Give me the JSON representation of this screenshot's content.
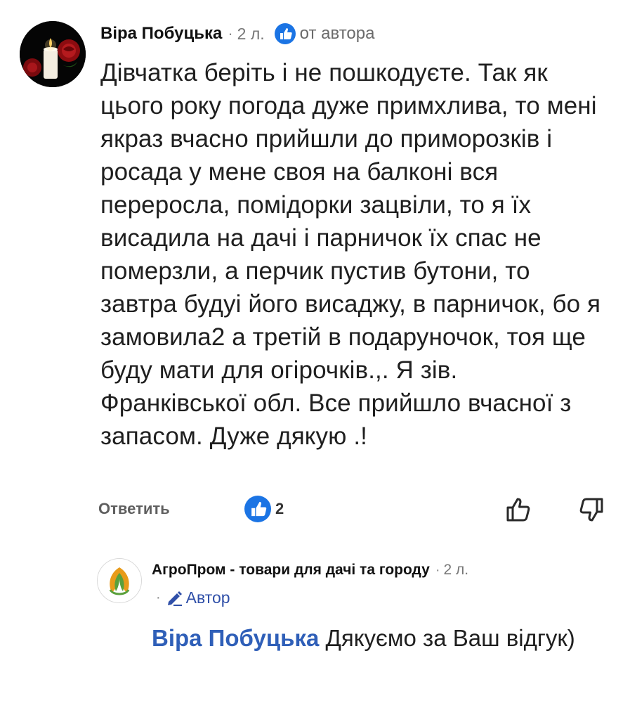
{
  "comment": {
    "author": "Віра Побуцька",
    "separator": "·",
    "time": "2 л.",
    "author_like_label": "от автора",
    "text": "Дівчатка беріть і не пошкодуєте. Так як цього року погода дуже примхлива, то мені якраз вчасно прийшли до приморозків і росада у мене своя на балконі вся переросла, помідорки зацвіли, то я їх висадила на дачі і парничок їх спас не померзли, а перчик пустив бутони, то завтра будуі його висаджу, в парничок, бо я замовила2 а третій в подаруночок, тоя ще буду мати для огірочків.,. Я зів. Франківської обл. Все прийшло вчасної з запасом. Дуже дякую .!",
    "reply_label": "Ответить",
    "like_count": "2"
  },
  "reply": {
    "author": "АгроПром - товари для дачі та городу",
    "separator": "·",
    "time": "2 л.",
    "separator2": "·",
    "badge": "Автор",
    "mention": "Віра Побуцька",
    "text": "Дякуємо за Ваш відгук)"
  },
  "colors": {
    "like_blue": "#1b74e4",
    "mention_blue": "#2f5fb8",
    "brand_orange": "#e89b1a",
    "brand_green": "#5aa03c"
  },
  "icons": {
    "like_badge": "thumbs-up-filled-icon",
    "thumb_up": "thumbs-up-outline-icon",
    "thumb_down": "thumbs-down-outline-icon",
    "pencil": "pencil-icon"
  }
}
